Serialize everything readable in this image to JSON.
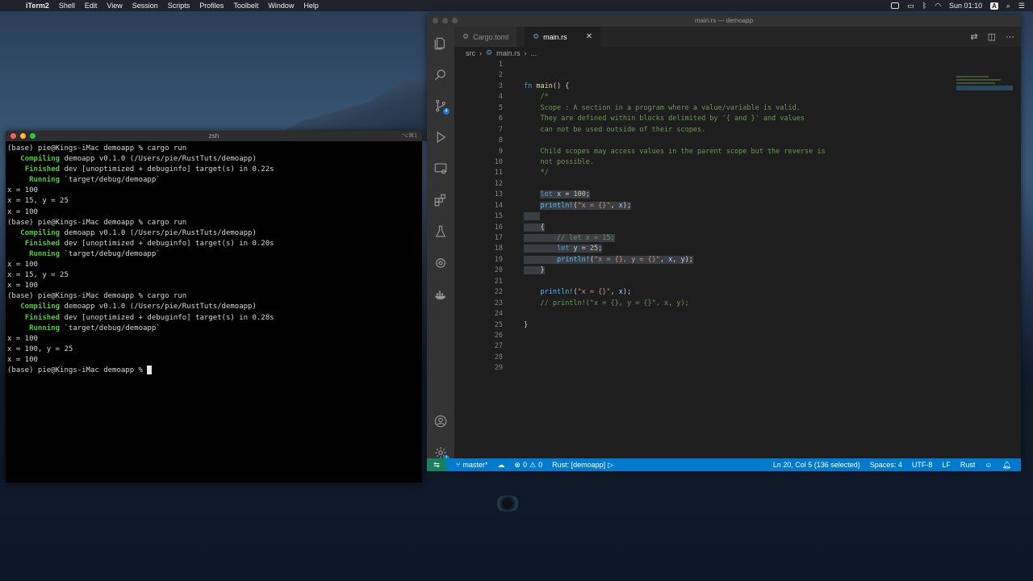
{
  "menubar": {
    "apple": "",
    "items": [
      "iTerm2",
      "Shell",
      "Edit",
      "View",
      "Session",
      "Scripts",
      "Profiles",
      "Toolbelt",
      "Window",
      "Help"
    ],
    "input_badge": "A",
    "clock": "Sun 01:10"
  },
  "terminal": {
    "title": "zsh",
    "shortcut": "⌥⌘1",
    "lines": [
      {
        "pre": "",
        "g": "",
        "t": "(base) pie@Kings-iMac demoapp % cargo run"
      },
      {
        "pre": "   ",
        "g": "Compiling",
        "t": " demoapp v0.1.0 (/Users/pie/RustTuts/demoapp)"
      },
      {
        "pre": "    ",
        "g": "Finished",
        "t": " dev [unoptimized + debuginfo] target(s) in 0.22s"
      },
      {
        "pre": "     ",
        "g": "Running",
        "t": " `target/debug/demoapp`"
      },
      {
        "pre": "",
        "g": "",
        "t": "x = 100"
      },
      {
        "pre": "",
        "g": "",
        "t": "x = 15, y = 25"
      },
      {
        "pre": "",
        "g": "",
        "t": "x = 100"
      },
      {
        "pre": "",
        "g": "",
        "t": "(base) pie@Kings-iMac demoapp % cargo run"
      },
      {
        "pre": "   ",
        "g": "Compiling",
        "t": " demoapp v0.1.0 (/Users/pie/RustTuts/demoapp)"
      },
      {
        "pre": "    ",
        "g": "Finished",
        "t": " dev [unoptimized + debuginfo] target(s) in 0.20s"
      },
      {
        "pre": "     ",
        "g": "Running",
        "t": " `target/debug/demoapp`"
      },
      {
        "pre": "",
        "g": "",
        "t": "x = 100"
      },
      {
        "pre": "",
        "g": "",
        "t": "x = 15, y = 25"
      },
      {
        "pre": "",
        "g": "",
        "t": "x = 100"
      },
      {
        "pre": "",
        "g": "",
        "t": "(base) pie@Kings-iMac demoapp % cargo run"
      },
      {
        "pre": "   ",
        "g": "Compiling",
        "t": " demoapp v0.1.0 (/Users/pie/RustTuts/demoapp)"
      },
      {
        "pre": "    ",
        "g": "Finished",
        "t": " dev [unoptimized + debuginfo] target(s) in 0.28s"
      },
      {
        "pre": "     ",
        "g": "Running",
        "t": " `target/debug/demoapp`"
      },
      {
        "pre": "",
        "g": "",
        "t": "x = 100"
      },
      {
        "pre": "",
        "g": "",
        "t": "x = 100, y = 25"
      },
      {
        "pre": "",
        "g": "",
        "t": "x = 100"
      }
    ],
    "prompt": "(base) pie@Kings-iMac demoapp % "
  },
  "vscode": {
    "title": "main.rs — demoapp",
    "tabs": [
      {
        "label": "Cargo.toml",
        "icon": "gear-icon",
        "active": false
      },
      {
        "label": "main.rs",
        "icon": "rust-icon",
        "active": true
      }
    ],
    "close_glyph": "✕",
    "breadcrumb": [
      "src",
      "main.rs",
      "..."
    ],
    "activity_badges": {
      "scm": "4",
      "settings": "1"
    },
    "code": [
      {
        "n": "1",
        "h": ""
      },
      {
        "n": "2",
        "h": ""
      },
      {
        "n": "3",
        "h": "<span class='kw'>fn</span> <span class='fn'>main</span>() {"
      },
      {
        "n": "4",
        "h": "    <span class='cm'>/*</span>"
      },
      {
        "n": "5",
        "h": "    <span class='cm'>Scope : A section in a program where a value/variable is valid.</span>"
      },
      {
        "n": "6",
        "h": "    <span class='cm'>They are defined within blocks delimited by '{ and }' and values</span>"
      },
      {
        "n": "7",
        "h": "    <span class='cm'>can not be used outside of their scopes.</span>"
      },
      {
        "n": "8",
        "h": ""
      },
      {
        "n": "9",
        "h": "    <span class='cm'>Child scopes may access values in the parent scope but the reverse is</span>"
      },
      {
        "n": "10",
        "h": "    <span class='cm'>not possible.</span>"
      },
      {
        "n": "11",
        "h": "    <span class='cm'>*/</span>"
      },
      {
        "n": "12",
        "h": ""
      },
      {
        "n": "13",
        "h": "    <span class='sel'><span class='kw'>let</span> <span class='var'>x</span> = <span class='num'>100</span>;</span>"
      },
      {
        "n": "14",
        "h": "    <span class='sel'><span class='mac'>println!</span>(<span class='str'>\"x = {}\"</span>, <span class='var'>x</span>);</span>"
      },
      {
        "n": "15",
        "h": "<span class='sel'>    </span>"
      },
      {
        "n": "16",
        "h": "<span class='sel'>    {</span>"
      },
      {
        "n": "17",
        "h": "<span class='sel'>        <span class='cm'>// let x = 15;</span></span>"
      },
      {
        "n": "18",
        "h": "<span class='sel'>        <span class='kw'>let</span> <span class='var'>y</span> = <span class='num'>25</span>;</span>"
      },
      {
        "n": "19",
        "h": "<span class='sel'>        <span class='mac'>println!</span>(<span class='str'>\"x = {}, y = {}\"</span>, <span class='var'>x</span>, <span class='var'>y</span>);</span>"
      },
      {
        "n": "20",
        "h": "<span class='sel'>    }</span>"
      },
      {
        "n": "21",
        "h": ""
      },
      {
        "n": "22",
        "h": "    <span class='mac'>println!</span>(<span class='str'>\"x = {}\"</span>, <span class='var'>x</span>);"
      },
      {
        "n": "23",
        "h": "    <span class='cm'>// println!(\"x = {}, y = {}\", x, y);</span>"
      },
      {
        "n": "24",
        "h": ""
      },
      {
        "n": "25",
        "h": "}"
      },
      {
        "n": "26",
        "h": ""
      },
      {
        "n": "27",
        "h": ""
      },
      {
        "n": "28",
        "h": ""
      },
      {
        "n": "29",
        "h": ""
      }
    ],
    "status": {
      "branch": "master*",
      "problems": "0",
      "warnings": "0",
      "run": "Rust: [demoapp]",
      "cursor": "Ln 20, Col 5 (136 selected)",
      "spaces": "Spaces: 4",
      "encoding": "UTF-8",
      "eol": "LF",
      "language": "Rust"
    }
  },
  "colors": {
    "status_bar": "#007acc",
    "terminal_green": "#4fcf3a",
    "remote": "#16825d"
  }
}
